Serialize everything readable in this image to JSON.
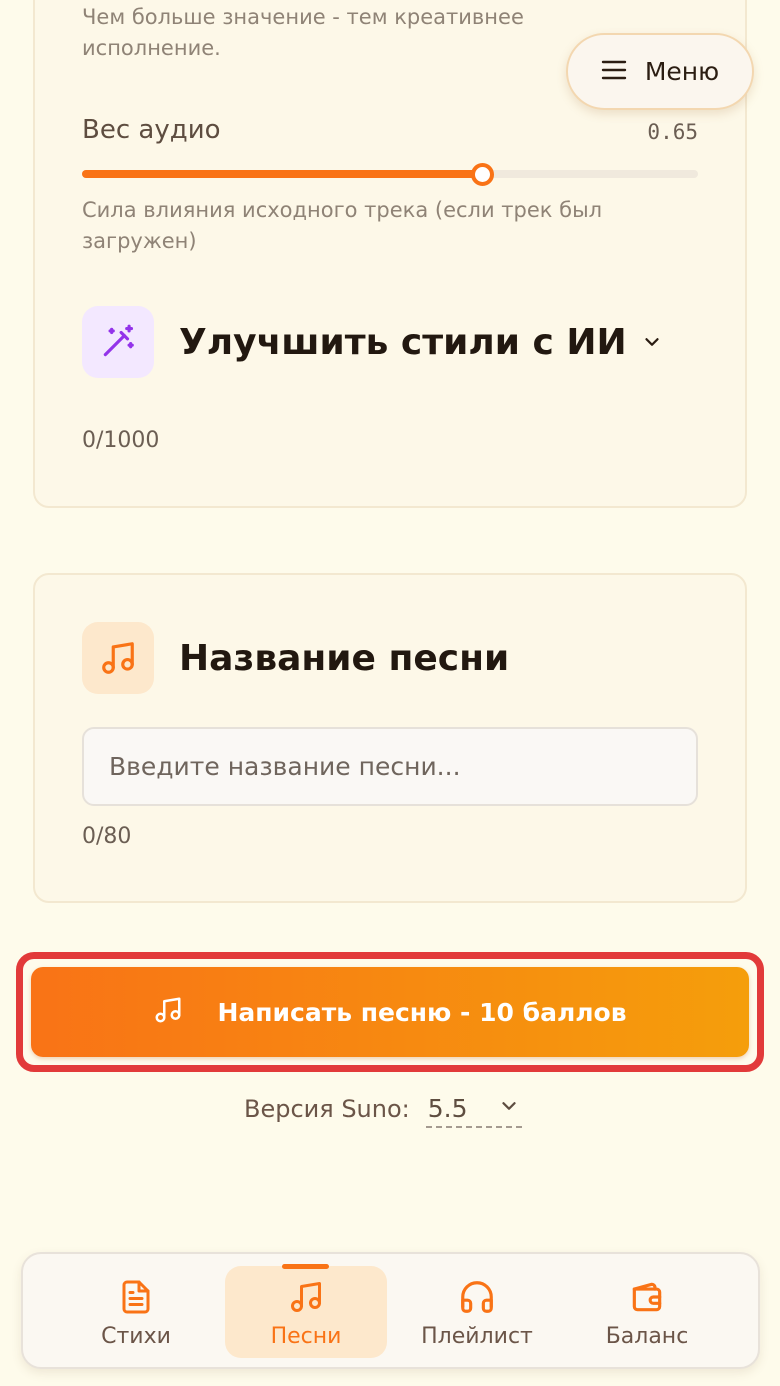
{
  "generation": {
    "creativity_hint": "Чем больше значение - тем креативнее исполнение.",
    "audio_weight": {
      "label": "Вес аудио",
      "value": "0.65",
      "fraction": 0.65,
      "hint": "Сила влияния исходного трека (если трек был загружен)"
    },
    "improve_styles": {
      "title": "Улучшить стили с ИИ",
      "icon": "magic-wand-icon",
      "counter": "0/1000"
    }
  },
  "song_title": {
    "title": "Название песни",
    "icon": "music-note-icon",
    "placeholder": "Введите название песни...",
    "value": "",
    "counter": "0/80"
  },
  "menu": {
    "label": "Меню",
    "icon": "hamburger-icon"
  },
  "cta": {
    "label": "Написать песню - 10 баллов",
    "icon": "music-note-icon"
  },
  "version": {
    "label": "Версия Suno:",
    "value": "5.5"
  },
  "nav": {
    "items": [
      {
        "label": "Стихи",
        "icon": "document-icon",
        "active": false
      },
      {
        "label": "Песни",
        "icon": "music-note-icon",
        "active": true
      },
      {
        "label": "Плейлист",
        "icon": "headphones-icon",
        "active": false
      },
      {
        "label": "Баланс",
        "icon": "wallet-icon",
        "active": false
      }
    ]
  },
  "colors": {
    "accent": "#f97316",
    "accent_end": "#f59e0b",
    "background": "#fefbeb",
    "highlight_outline": "#e23a3a",
    "purple_icon": "#9333ea"
  }
}
